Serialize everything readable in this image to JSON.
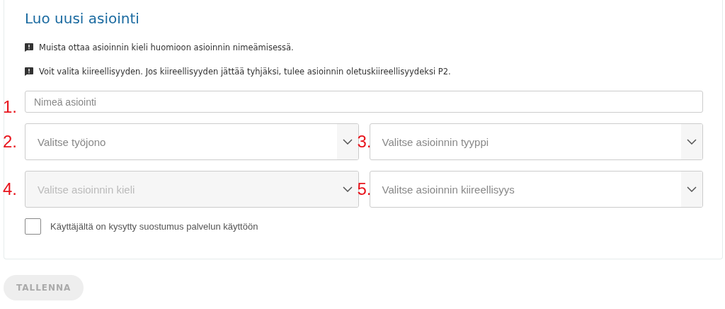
{
  "title": "Luo uusi asiointi",
  "notes": [
    "Muista ottaa asioinnin kieli huomioon asioinnin nimeämisessä.",
    "Voit valita kiireellisyyden. Jos kiireellisyyden jättää tyhjäksi, tulee asioinnin oletuskiireellisyydeksi P2."
  ],
  "fields": [
    {
      "number": "1.",
      "kind": "text",
      "placeholder": "Nimeä asiointi",
      "disabled": false
    },
    {
      "number": "2.",
      "kind": "select",
      "placeholder": "Valitse työjono",
      "disabled": false
    },
    {
      "number": "3.",
      "kind": "select",
      "placeholder": "Valitse asioinnin tyyppi",
      "disabled": false
    },
    {
      "number": "4.",
      "kind": "select",
      "placeholder": "Valitse asioinnin kieli",
      "disabled": true
    },
    {
      "number": "5.",
      "kind": "select",
      "placeholder": "Valitse asioinnin kiireellisyys",
      "disabled": false
    }
  ],
  "consent": {
    "label": "Käyttäjältä on kysytty suostumus palvelun käyttöön",
    "checked": false
  },
  "save_button": {
    "label": "TALLENNA",
    "disabled": true
  }
}
